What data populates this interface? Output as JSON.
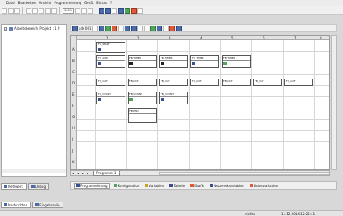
{
  "menu": [
    "Datei",
    "Bearbeiten",
    "Ansicht",
    "Programmierung",
    "Gerät",
    "Extras",
    "?"
  ],
  "toolbar": {
    "zoom": "100%"
  },
  "project": {
    "tree_label": "Arbeitsbereich 'Projekt' : 1 P"
  },
  "left_tabs": [
    "Netzwerk",
    "Debug"
  ],
  "editor_toolbar": {
    "field_label": "adr 001"
  },
  "columns": [
    "1",
    "2",
    "3",
    "4",
    "5",
    "6",
    "7",
    "8"
  ],
  "rows": [
    "A",
    "B",
    "C",
    "D",
    "E",
    "F",
    "G",
    "H",
    "I",
    "J",
    "K"
  ],
  "sheet_tab": "Programm 1",
  "view_tabs": [
    "Programmierung",
    "Konfiguration",
    "Variablen",
    "Tabelle",
    "Grafik",
    "Netzwerkvariablen",
    "Listenvariablen"
  ],
  "bottom_tabs": [
    "Nachrichten",
    "Eingabezeile"
  ],
  "status": {
    "left": "nichts",
    "right": "11.12.2014 12:25:41"
  },
  "blocks": [
    {
      "label": "FB_START"
    },
    {
      "label": "FB_AND"
    },
    {
      "label": "FB_TIMER"
    },
    {
      "label": "FB_TIMER"
    },
    {
      "label": "FB_TIMER"
    },
    {
      "label": "FB_TIMER"
    },
    {
      "label": "FB_OUT"
    },
    {
      "label": "FB_OUT"
    },
    {
      "label": "FB_OUT"
    },
    {
      "label": "FB_OUT"
    },
    {
      "label": "FB_OUT"
    },
    {
      "label": "FB_OUT"
    },
    {
      "label": "FB_OUT"
    },
    {
      "label": "FB_COUNT"
    },
    {
      "label": "FB_COUNT"
    },
    {
      "label": "FB_COUNT"
    },
    {
      "label": "FB_END"
    }
  ]
}
